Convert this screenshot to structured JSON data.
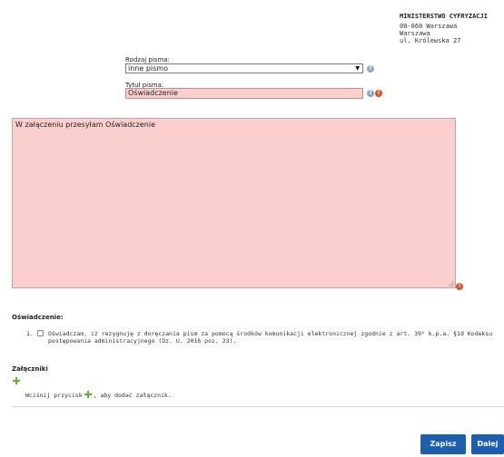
{
  "recipient": {
    "name": "MINISTERSTWO CYFRYZACJI",
    "postal": "00-060 Warszawa",
    "city": "Warszawa",
    "street": "ul. Królewska 27"
  },
  "form": {
    "type_label": "Rodzaj pisma:",
    "type_value": "inne pismo",
    "title_label": "Tytuł pisma:",
    "title_value": "Oświadczenie",
    "content_value": "W załączeniu przesyłam Oświadczenie"
  },
  "declaration": {
    "heading": "Oświadczenie:",
    "item_number": "1.",
    "item_text": "Oświadczam, iż rezygnuję z doręczania pism za pomocą środków komunikacji elektronicznej zgodnie z art. 39¹ k.p.a. §1d Kodeksu postępowania administracyjnego (Dz. U. 2016 poz. 23)."
  },
  "attachments": {
    "heading": "Załączniki",
    "hint_before": "Wciśnij przycisk",
    "hint_after": ", aby dodać załącznik."
  },
  "buttons": {
    "save": "Zapisz",
    "next": "Dalej"
  },
  "colors": {
    "error_field": "#fccfcf",
    "primary_button": "#1b5fae",
    "help_icon": "#8aa6c8",
    "error_icon": "#e0512a",
    "plus_icon": "#5cb32e"
  }
}
